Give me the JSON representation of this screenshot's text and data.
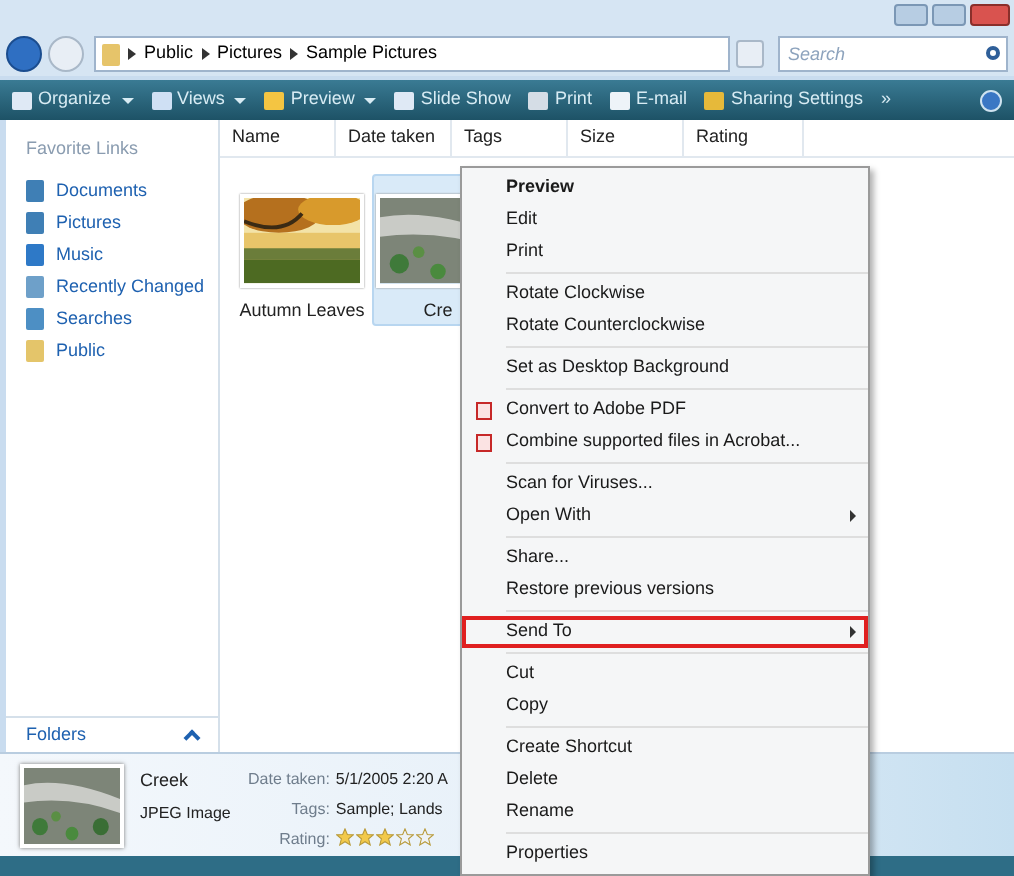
{
  "address": {
    "crumbs": [
      "Public",
      "Pictures",
      "Sample Pictures"
    ]
  },
  "search": {
    "placeholder": "Search"
  },
  "toolbar": [
    {
      "label": "Organize",
      "dropdown": true
    },
    {
      "label": "Views",
      "dropdown": true
    },
    {
      "label": "Preview",
      "dropdown": true
    },
    {
      "label": "Slide Show",
      "dropdown": false
    },
    {
      "label": "Print",
      "dropdown": false
    },
    {
      "label": "E-mail",
      "dropdown": false
    },
    {
      "label": "Sharing Settings",
      "dropdown": false
    },
    {
      "label": "»",
      "dropdown": false
    }
  ],
  "columns": [
    "Name",
    "Date taken",
    "Tags",
    "Size",
    "Rating"
  ],
  "sidebar": {
    "title": "Favorite Links",
    "items": [
      {
        "label": "Documents"
      },
      {
        "label": "Pictures"
      },
      {
        "label": "Music"
      },
      {
        "label": "Recently Changed"
      },
      {
        "label": "Searches"
      },
      {
        "label": "Public"
      }
    ],
    "footer": "Folders"
  },
  "files": [
    {
      "name": "Autumn Leaves",
      "selected": false
    },
    {
      "name": "Cre",
      "selected": true
    }
  ],
  "menu": [
    [
      {
        "label": "Preview",
        "kind": "default",
        "highlighted": false
      },
      {
        "label": "Edit",
        "kind": "plain",
        "highlighted": false
      },
      {
        "label": "Print",
        "kind": "plain",
        "highlighted": false
      }
    ],
    [
      {
        "label": "Rotate Clockwise",
        "kind": "plain",
        "highlighted": false
      },
      {
        "label": "Rotate Counterclockwise",
        "kind": "plain",
        "highlighted": false
      }
    ],
    [
      {
        "label": "Set as Desktop Background",
        "kind": "plain",
        "highlighted": false
      }
    ],
    [
      {
        "label": "Convert to Adobe PDF",
        "kind": "pdf",
        "highlighted": false
      },
      {
        "label": "Combine supported files in Acrobat...",
        "kind": "pdf",
        "highlighted": false
      }
    ],
    [
      {
        "label": "Scan for Viruses...",
        "kind": "plain",
        "highlighted": false
      },
      {
        "label": "Open With",
        "kind": "submenu",
        "highlighted": false
      }
    ],
    [
      {
        "label": "Share...",
        "kind": "plain",
        "highlighted": false
      },
      {
        "label": "Restore previous versions",
        "kind": "plain",
        "highlighted": false
      }
    ],
    [
      {
        "label": "Send To",
        "kind": "submenu",
        "highlighted": true
      }
    ],
    [
      {
        "label": "Cut",
        "kind": "plain",
        "highlighted": false
      },
      {
        "label": "Copy",
        "kind": "plain",
        "highlighted": false
      }
    ],
    [
      {
        "label": "Create Shortcut",
        "kind": "plain",
        "highlighted": false
      },
      {
        "label": "Delete",
        "kind": "plain",
        "highlighted": false
      },
      {
        "label": "Rename",
        "kind": "plain",
        "highlighted": false
      }
    ],
    [
      {
        "label": "Properties",
        "kind": "plain",
        "highlighted": false
      }
    ]
  ],
  "details": {
    "name": "Creek",
    "type": "JPEG Image",
    "fields": [
      {
        "label": "Date taken:",
        "value": "5/1/2005 2:20 A"
      },
      {
        "label": "Tags:",
        "value": "Sample; Lands"
      }
    ],
    "rating_label": "Rating:",
    "stars": 3
  }
}
